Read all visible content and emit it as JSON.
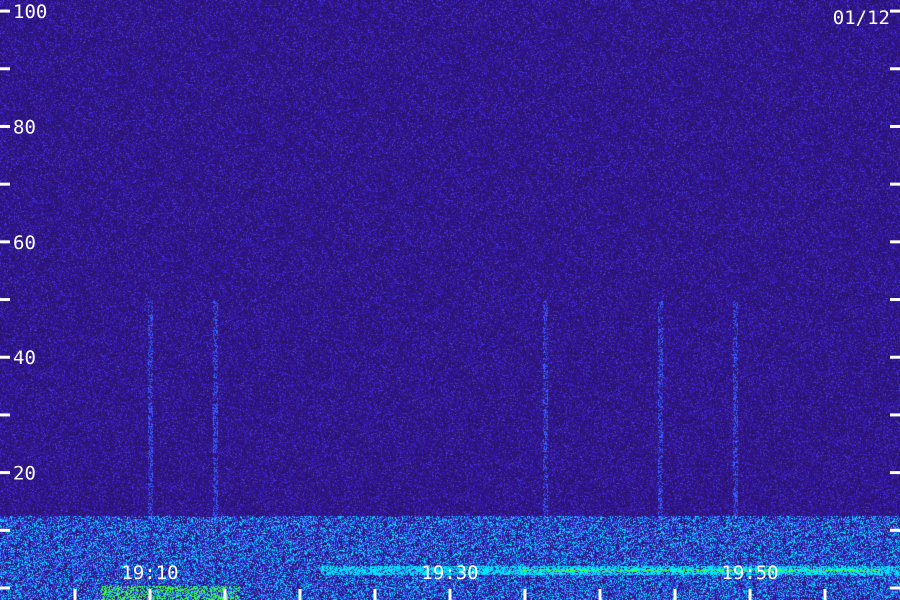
{
  "chart_data": {
    "type": "heatmap",
    "date_label": "01/12",
    "y_axis": {
      "range": [
        0,
        104
      ],
      "ticks": [
        {
          "value": 0,
          "label": ""
        },
        {
          "value": 10,
          "label": ""
        },
        {
          "value": 20,
          "label": "20"
        },
        {
          "value": 30,
          "label": ""
        },
        {
          "value": 40,
          "label": "40"
        },
        {
          "value": 50,
          "label": ""
        },
        {
          "value": 60,
          "label": "60"
        },
        {
          "value": 70,
          "label": ""
        },
        {
          "value": 80,
          "label": "80"
        },
        {
          "value": 90,
          "label": ""
        },
        {
          "value": 100,
          "label": "100"
        }
      ]
    },
    "x_axis": {
      "range": [
        "19:00",
        "20:00"
      ],
      "tick_minutes": [
        5,
        10,
        15,
        20,
        25,
        30,
        35,
        40,
        45,
        50,
        55
      ],
      "labels": [
        {
          "minute": 10,
          "label": "19:10"
        },
        {
          "minute": 30,
          "label": "19:30"
        },
        {
          "minute": 50,
          "label": "19:50"
        }
      ]
    },
    "colors": {
      "background": "#1f0f55",
      "noise": [
        "#2a1470",
        "#3516a0",
        "#3c22c8",
        "#4a3ae0"
      ],
      "signal_weak": "#3560ff",
      "signal_strong": "#00e8ff",
      "signal_peak": "#40ff40",
      "axis": "#ffffff"
    }
  }
}
